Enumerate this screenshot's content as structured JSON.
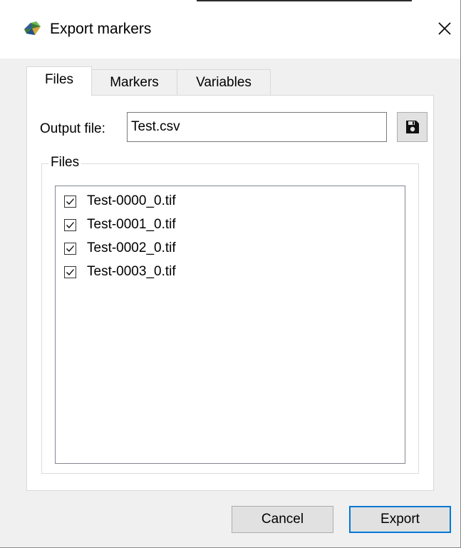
{
  "window": {
    "title": "Export markers",
    "icon": "app-logo-icon",
    "close_icon": "close-icon"
  },
  "tabs": [
    {
      "label": "Files",
      "active": true
    },
    {
      "label": "Markers",
      "active": false
    },
    {
      "label": "Variables",
      "active": false
    }
  ],
  "output": {
    "label": "Output file:",
    "value": "Test.csv",
    "save_icon": "floppy-disk-icon"
  },
  "files_group": {
    "title": "Files",
    "items": [
      {
        "name": "Test-0000_0.tif",
        "checked": true
      },
      {
        "name": "Test-0001_0.tif",
        "checked": true
      },
      {
        "name": "Test-0002_0.tif",
        "checked": true
      },
      {
        "name": "Test-0003_0.tif",
        "checked": true
      }
    ]
  },
  "buttons": {
    "cancel": "Cancel",
    "export": "Export"
  },
  "colors": {
    "accent": "#0078d7",
    "background": "#f0f0f0",
    "titlebar": "#ffffff"
  }
}
